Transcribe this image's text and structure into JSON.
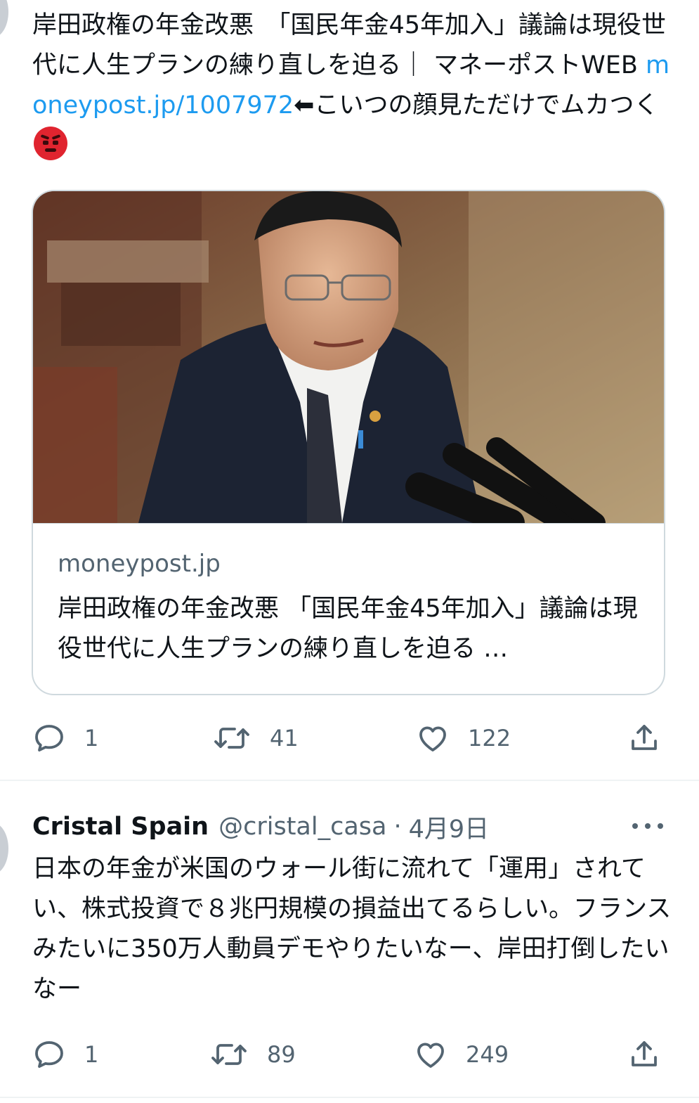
{
  "tweet1": {
    "text_before_link": "岸田政権の年金改悪　「国民年金45年加入」議論は現役世代に人生プランの練り直しを迫る｜ マネーポストWEB ",
    "link": "moneypost.jp/1007972",
    "text_after_link": "⬅︎こいつの顔見ただけでムカつく",
    "emoji": "angry-face-emoji",
    "card": {
      "domain": "moneypost.jp",
      "title": "岸田政権の年金改悪 「国民年金45年加入」議論は現役世代に人生プランの練り直しを迫る …"
    },
    "actions": {
      "reply_count": "1",
      "retweet_count": "41",
      "like_count": "122"
    }
  },
  "tweet2": {
    "author_name": "Cristal Spain",
    "author_handle": "@cristal_casa",
    "dot": "·",
    "date": "4月9日",
    "text": "日本の年金が米国のウォール街に流れて「運用」されてい、株式投資で８兆円規模の損益出てるらしい。フランスみたいに350万人動員デモやりたいなー、岸田打倒したいなー",
    "actions": {
      "reply_count": "1",
      "retweet_count": "89",
      "like_count": "249"
    }
  },
  "icons": [
    "reply-icon",
    "retweet-icon",
    "like-icon",
    "share-icon",
    "more-icon"
  ],
  "colors": {
    "link": "#1d9bf0",
    "muted": "#536471",
    "text": "#0f1419",
    "border": "#cfd9de"
  }
}
